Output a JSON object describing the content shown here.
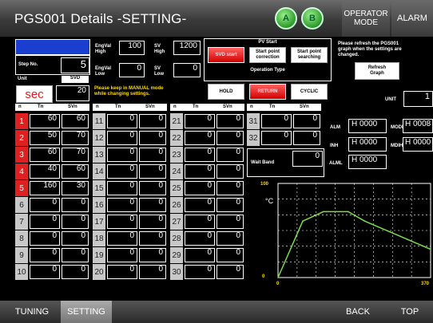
{
  "header": {
    "title": "PGS001 Details  -SETTING-",
    "indicator_a": "A",
    "indicator_b": "B",
    "operator_mode": "OPERATOR\nMODE",
    "alarm": "ALARM"
  },
  "left": {
    "step_no_label": "Step No.",
    "step_no_value": "5",
    "unit_label": "Unit",
    "svd_label": "SVD",
    "unit_value": "sec",
    "svd_value": "20"
  },
  "engval": {
    "high_label": "EngVal\nHigh",
    "high_value": "100",
    "low_label": "EngVal\nLow",
    "low_value": "0",
    "sv_high_label": "SV\nHigh",
    "sv_high_value": "1200",
    "sv_low_label": "SV\nLow",
    "sv_low_value": "0",
    "note": "Please keep in MANUAL mode\nwhile changing settings."
  },
  "pv_start": {
    "title": "PV Start",
    "svd_start": "SVD start",
    "correction": "Start point\ncorrection",
    "searching": "Start point\nsearching"
  },
  "operation_type": {
    "title": "Operation Type",
    "hold": "HOLD",
    "return": "RETURN",
    "cyclic": "CYCLIC"
  },
  "refresh": {
    "note": "Please refresh the PGS001\ngraph when the settings are\nchanged.",
    "button": "Refresh\nGraph"
  },
  "unit_box": {
    "label": "UNIT",
    "value": "1"
  },
  "table_headers": {
    "n": "n",
    "tn": "Tn",
    "svn": "SVn"
  },
  "steps": [
    {
      "n": "1",
      "tn": "60",
      "svn": "60",
      "active": true
    },
    {
      "n": "2",
      "tn": "50",
      "svn": "70",
      "active": true
    },
    {
      "n": "3",
      "tn": "60",
      "svn": "70",
      "active": true
    },
    {
      "n": "4",
      "tn": "40",
      "svn": "60",
      "active": true
    },
    {
      "n": "5",
      "tn": "160",
      "svn": "30",
      "active": true
    },
    {
      "n": "6",
      "tn": "0",
      "svn": "0",
      "active": false
    },
    {
      "n": "7",
      "tn": "0",
      "svn": "0",
      "active": false
    },
    {
      "n": "8",
      "tn": "0",
      "svn": "0",
      "active": false
    },
    {
      "n": "9",
      "tn": "0",
      "svn": "0",
      "active": false
    },
    {
      "n": "10",
      "tn": "0",
      "svn": "0",
      "active": false
    },
    {
      "n": "11",
      "tn": "0",
      "svn": "0",
      "active": false
    },
    {
      "n": "12",
      "tn": "0",
      "svn": "0",
      "active": false
    },
    {
      "n": "13",
      "tn": "0",
      "svn": "0",
      "active": false
    },
    {
      "n": "14",
      "tn": "0",
      "svn": "0",
      "active": false
    },
    {
      "n": "15",
      "tn": "0",
      "svn": "0",
      "active": false
    },
    {
      "n": "16",
      "tn": "0",
      "svn": "0",
      "active": false
    },
    {
      "n": "17",
      "tn": "0",
      "svn": "0",
      "active": false
    },
    {
      "n": "18",
      "tn": "0",
      "svn": "0",
      "active": false
    },
    {
      "n": "19",
      "tn": "0",
      "svn": "0",
      "active": false
    },
    {
      "n": "20",
      "tn": "0",
      "svn": "0",
      "active": false
    },
    {
      "n": "21",
      "tn": "0",
      "svn": "0",
      "active": false
    },
    {
      "n": "22",
      "tn": "0",
      "svn": "0",
      "active": false
    },
    {
      "n": "23",
      "tn": "0",
      "svn": "0",
      "active": false
    },
    {
      "n": "24",
      "tn": "0",
      "svn": "0",
      "active": false
    },
    {
      "n": "25",
      "tn": "0",
      "svn": "0",
      "active": false
    },
    {
      "n": "26",
      "tn": "0",
      "svn": "0",
      "active": false
    },
    {
      "n": "27",
      "tn": "0",
      "svn": "0",
      "active": false
    },
    {
      "n": "28",
      "tn": "0",
      "svn": "0",
      "active": false
    },
    {
      "n": "29",
      "tn": "0",
      "svn": "0",
      "active": false
    },
    {
      "n": "30",
      "tn": "0",
      "svn": "0",
      "active": false
    },
    {
      "n": "31",
      "tn": "0",
      "svn": "0",
      "active": false
    },
    {
      "n": "32",
      "tn": "0",
      "svn": "0",
      "active": false
    }
  ],
  "wait_band": {
    "label": "Wait Band",
    "value": "0"
  },
  "alarms": {
    "alm_label": "ALM",
    "alm_value": "H 0000",
    "inh_label": "INH",
    "inh_value": "H 0000",
    "alml_label": "ALML",
    "alml_value": "H 0000",
    "mode_label": "MODE",
    "mode_value": "H 0008",
    "mdih_label": "MDIH",
    "mdih_value": "H 0000"
  },
  "chart_data": {
    "type": "line",
    "ylabel": "°C",
    "y_top_label": "100",
    "y_bottom_label": "0",
    "x_left_label": "0",
    "x_right_label": "370",
    "x": [
      0,
      60,
      110,
      170,
      210,
      370
    ],
    "y": [
      0,
      60,
      70,
      70,
      60,
      30
    ],
    "xlim": [
      0,
      370
    ],
    "ylim": [
      0,
      100
    ],
    "color": "#7ddc4a",
    "grid": true
  },
  "footer": {
    "tuning": "TUNING",
    "setting": "SETTING",
    "back": "BACK",
    "top": "TOP"
  },
  "colors": {
    "active_red": "#e02020",
    "accent_blue": "#1a3fd0",
    "green_line": "#7ddc4a"
  }
}
